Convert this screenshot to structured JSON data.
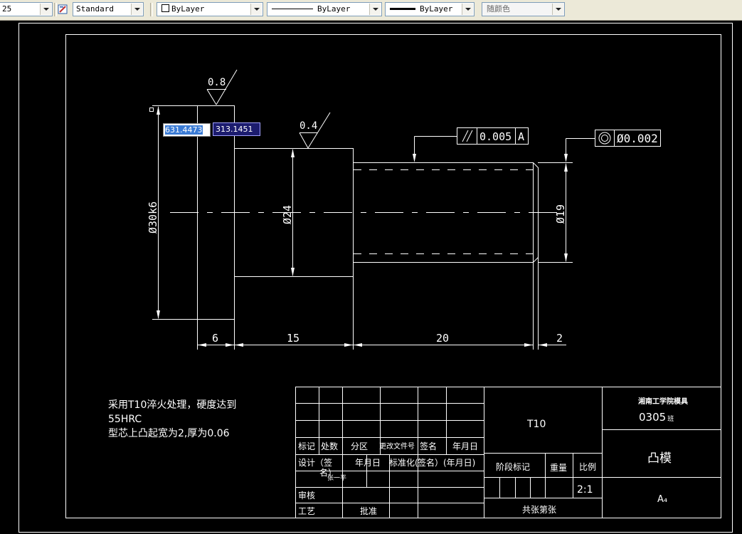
{
  "toolbar": {
    "dim_scale": "25",
    "text_style": "Standard",
    "layer_color": "ByLayer",
    "linetype": "ByLayer",
    "lineweight": "ByLayer",
    "plot_style": "随颜色"
  },
  "dynamic_input": {
    "x_value": "631.4473",
    "y_value": "313.1451"
  },
  "drawing": {
    "roughness_left": "0.8",
    "roughness_mid": "0.4",
    "parallel_tolerance": "0.005",
    "parallel_datum": "A",
    "concentric_tolerance": "Ø0.002",
    "dim_dia_left": "Ø30k6",
    "dim_dia_mid": "Ø24",
    "dim_dia_right": "Ø19",
    "dim_len_1": "6",
    "dim_len_2": "15",
    "dim_len_3": "20",
    "dim_len_4": "2"
  },
  "notes": {
    "line1": "采用T10淬火处理，硬度达到",
    "line2": "55HRC",
    "line3": "型芯上凸起宽为2,厚为0.06"
  },
  "title_block": {
    "material": "T10",
    "school": "湘南工学院模具",
    "class_code": "0305",
    "class_suffix": "班",
    "part_name": "凸模",
    "sheet_size": "A₄",
    "scale": "2:1",
    "label_mark": "标记",
    "label_count": "处数",
    "label_zone": "分区",
    "label_change_doc": "更改文件号",
    "label_sign": "签名",
    "label_date": "年月日",
    "label_design": "设计（签",
    "label_design_overlap": "名）",
    "label_designer": "张一平",
    "label_date2": "年月日",
    "label_standard": "标准化(",
    "label_sign_date": "签名）(年月日)",
    "label_stage": "阶段标记",
    "label_weight": "重量",
    "label_ratio": "比例",
    "label_review": "审核",
    "label_process": "工艺",
    "label_approve": "批准",
    "label_sheets": "共张第张"
  }
}
